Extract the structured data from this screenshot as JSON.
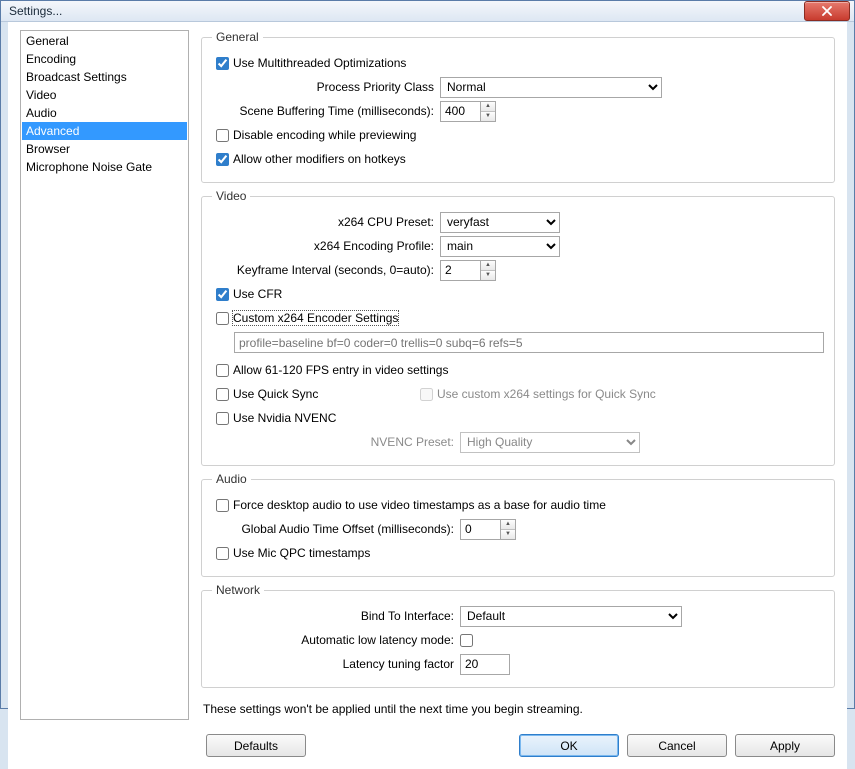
{
  "window": {
    "title": "Settings..."
  },
  "sidebar": {
    "items": [
      {
        "label": "General"
      },
      {
        "label": "Encoding"
      },
      {
        "label": "Broadcast Settings"
      },
      {
        "label": "Video"
      },
      {
        "label": "Audio"
      },
      {
        "label": "Advanced"
      },
      {
        "label": "Browser"
      },
      {
        "label": "Microphone Noise Gate"
      }
    ],
    "selected_index": 5
  },
  "general": {
    "legend": "General",
    "use_multithreaded": {
      "label": "Use Multithreaded Optimizations",
      "checked": true
    },
    "priority_label": "Process Priority Class",
    "priority_value": "Normal",
    "scene_buffer_label": "Scene Buffering Time (milliseconds):",
    "scene_buffer_value": "400",
    "disable_encoding": {
      "label": "Disable encoding while previewing",
      "checked": false
    },
    "allow_modifiers": {
      "label": "Allow other modifiers on hotkeys",
      "checked": true
    }
  },
  "video": {
    "legend": "Video",
    "preset_label": "x264 CPU Preset:",
    "preset_value": "veryfast",
    "profile_label": "x264 Encoding Profile:",
    "profile_value": "main",
    "keyframe_label": "Keyframe Interval (seconds, 0=auto):",
    "keyframe_value": "2",
    "use_cfr": {
      "label": "Use CFR",
      "checked": true
    },
    "custom_x264": {
      "label": "Custom x264 Encoder Settings",
      "checked": false
    },
    "custom_x264_placeholder": "profile=baseline bf=0 coder=0 trellis=0 subq=6 refs=5",
    "allow_fps": {
      "label": "Allow 61-120 FPS entry in video settings",
      "checked": false
    },
    "use_quicksync": {
      "label": "Use Quick Sync",
      "checked": false
    },
    "use_custom_qs": {
      "label": "Use custom x264 settings for Quick Sync",
      "checked": false
    },
    "use_nvenc": {
      "label": "Use Nvidia NVENC",
      "checked": false
    },
    "nvenc_label": "NVENC Preset:",
    "nvenc_value": "High Quality"
  },
  "audio": {
    "legend": "Audio",
    "force_ts": {
      "label": "Force desktop audio to use video timestamps as a base for audio time",
      "checked": false
    },
    "offset_label": "Global Audio Time Offset (milliseconds):",
    "offset_value": "0",
    "mic_qpc": {
      "label": "Use Mic QPC timestamps",
      "checked": false
    }
  },
  "network": {
    "legend": "Network",
    "bind_label": "Bind To Interface:",
    "bind_value": "Default",
    "auto_lowlat_label": "Automatic low latency mode:",
    "auto_lowlat_checked": false,
    "latency_label": "Latency tuning factor",
    "latency_value": "20"
  },
  "note": "These settings won't be applied until the next time you begin streaming.",
  "buttons": {
    "defaults": "Defaults",
    "ok": "OK",
    "cancel": "Cancel",
    "apply": "Apply"
  }
}
